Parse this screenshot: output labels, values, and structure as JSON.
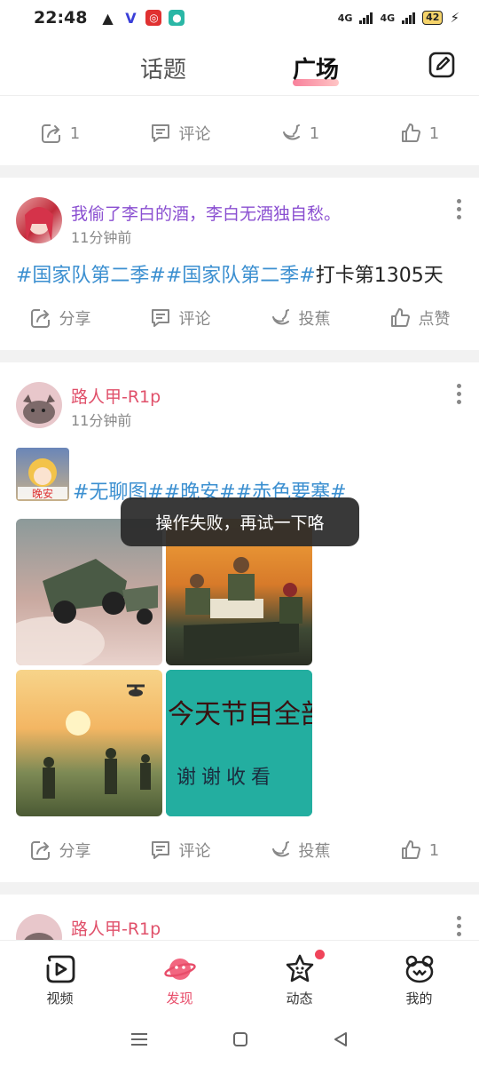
{
  "status_bar": {
    "time": "22:48",
    "battery": "42",
    "network_1": "4G",
    "network_2": "4G"
  },
  "header": {
    "tab_topic": "话题",
    "tab_square": "广场"
  },
  "post0_actions": {
    "share": "1",
    "comment": "评论",
    "banana": "1",
    "like": "1"
  },
  "post1": {
    "username": "我偷了李白的酒，李白无酒独自愁。",
    "time": "11分钟前",
    "tag1": "#国家队第二季#",
    "tag2": "#国家队第二季#",
    "text_tail": "打卡第1305天",
    "actions": {
      "share": "分享",
      "comment": "评论",
      "banana": "投蕉",
      "like": "点赞"
    }
  },
  "post2": {
    "username": "路人甲-R1p",
    "time": "11分钟前",
    "tags": "#无聊图##晚安##赤色要塞#",
    "thumb_text": "晚安",
    "image4_line1": "今天节目全部结束",
    "image4_line2": "谢谢收看",
    "actions": {
      "share": "分享",
      "comment": "评论",
      "banana": "投蕉",
      "like": "1"
    }
  },
  "post3": {
    "username": "路人甲-R1p"
  },
  "toast": "操作失败，再试一下咯",
  "bottom_nav": {
    "video": "视频",
    "discover": "发现",
    "dynamic": "动态",
    "mine": "我的"
  },
  "colors": {
    "accent": "#e84d6a",
    "tag": "#3b8fd0",
    "username_purple": "#8a4fd1",
    "username_red": "#e0506a"
  }
}
